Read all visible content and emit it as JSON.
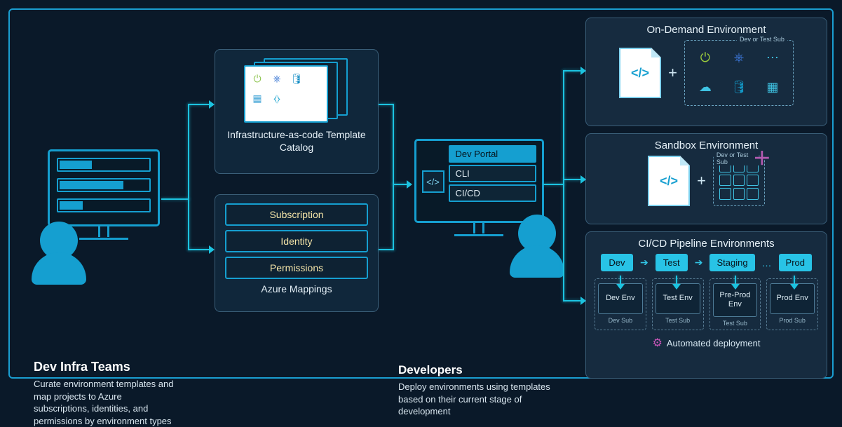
{
  "dev_infra": {
    "title": "Dev Infra Teams",
    "desc": "Curate environment templates and map projects to Azure subscriptions, identities, and permissions by environment types"
  },
  "iac": {
    "label": "Infrastructure-as-code Template Catalog"
  },
  "mappings": {
    "items": [
      "Subscription",
      "Identity",
      "Permissions"
    ],
    "label": "Azure Mappings"
  },
  "developers": {
    "title": "Developers",
    "desc": "Deploy environments using templates based on their current stage of development",
    "options": [
      "Dev Portal",
      "CLI",
      "CI/CD"
    ]
  },
  "env_ondemand": {
    "title": "On-Demand Environment",
    "sub_label": "Dev or Test Sub"
  },
  "env_sandbox": {
    "title": "Sandbox Environment",
    "sub_label": "Dev or Test Sub"
  },
  "env_cicd": {
    "title": "CI/CD Pipeline Environments",
    "stages": [
      "Dev",
      "Test",
      "Staging",
      "Prod"
    ],
    "ellipsis": "…",
    "envs": [
      {
        "name": "Dev Env",
        "sub": "Dev Sub"
      },
      {
        "name": "Test Env",
        "sub": "Test Sub"
      },
      {
        "name": "Pre-Prod Env",
        "sub": "Test Sub"
      },
      {
        "name": "Prod Env",
        "sub": "Prod Sub"
      }
    ],
    "auto": "Automated deployment"
  },
  "glyph": {
    "code": "</>",
    "plus": "+"
  }
}
